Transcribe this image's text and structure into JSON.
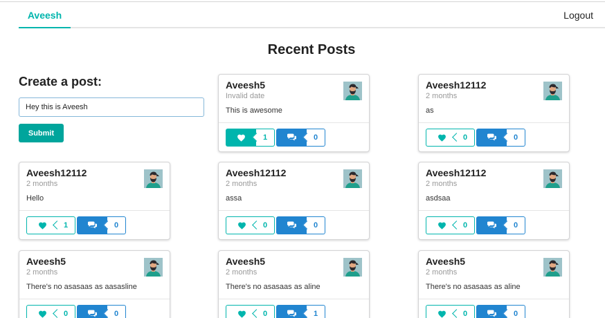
{
  "nav": {
    "brand": "Aveesh",
    "logout": "Logout"
  },
  "page_title": "Recent Posts",
  "create": {
    "title": "Create a post:",
    "input_value": "Hey this is Aveesh",
    "submit": "Submit"
  },
  "posts": [
    {
      "author": "Aveesh5",
      "date": "Invalid date",
      "text": "This is awesome",
      "likes": "1",
      "comments": "0",
      "liked": true
    },
    {
      "author": "Aveesh12112",
      "date": "2 months",
      "text": "as",
      "likes": "0",
      "comments": "0",
      "liked": false
    },
    {
      "author": "Aveesh12112",
      "date": "2 months",
      "text": "Hello",
      "likes": "1",
      "comments": "0",
      "liked": false
    },
    {
      "author": "Aveesh12112",
      "date": "2 months",
      "text": "assa",
      "likes": "0",
      "comments": "0",
      "liked": false
    },
    {
      "author": "Aveesh12112",
      "date": "2 months",
      "text": "asdsaa",
      "likes": "0",
      "comments": "0",
      "liked": false
    },
    {
      "author": "Aveesh5",
      "date": "2 months",
      "text": "There's no asasaas as aasasline",
      "likes": "0",
      "comments": "0",
      "liked": false
    },
    {
      "author": "Aveesh5",
      "date": "2 months",
      "text": "There's no asasaas as aline",
      "likes": "0",
      "comments": "1",
      "liked": false
    },
    {
      "author": "Aveesh5",
      "date": "2 months",
      "text": "There's no asasaas as aline",
      "likes": "0",
      "comments": "0",
      "liked": false
    }
  ],
  "colors": {
    "teal": "#00b5ad",
    "blue": "#2185d0"
  },
  "icons": {
    "like": "heart-icon",
    "comment": "comments-icon",
    "avatar": "avatar"
  }
}
